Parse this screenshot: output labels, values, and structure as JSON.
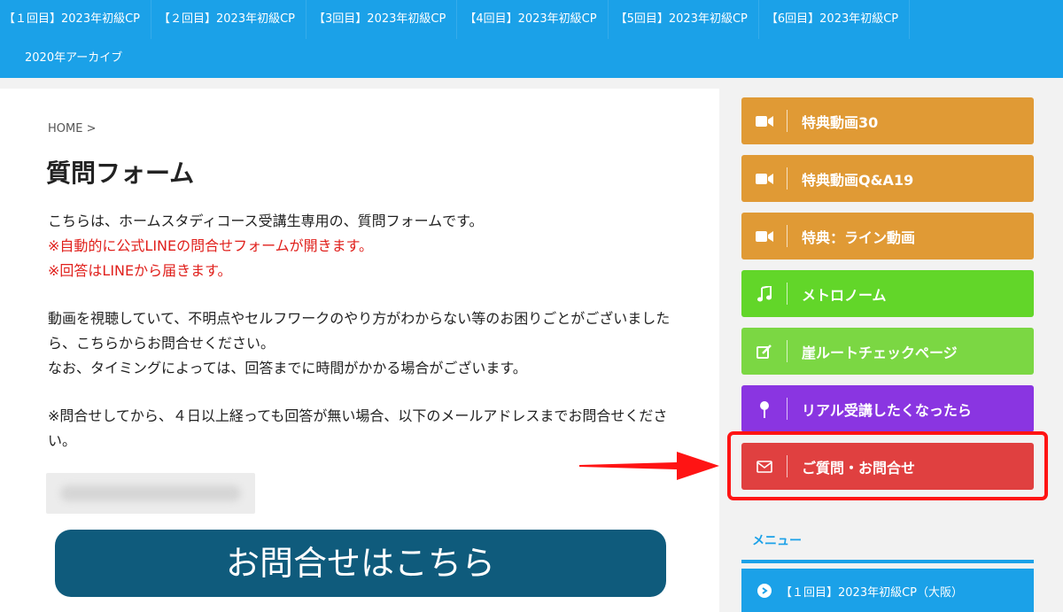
{
  "topnav": {
    "row1": [
      "【１回目】2023年初級CP",
      "【２回目】2023年初級CP",
      "【3回目】2023年初級CP",
      "【4回目】2023年初級CP",
      "【5回目】2023年初級CP",
      "【6回目】2023年初級CP"
    ],
    "row2": [
      "2020年アーカイブ"
    ]
  },
  "main": {
    "breadcrumb": "HOME >",
    "title": "質問フォーム",
    "intro": "こちらは、ホームスタディコース受講生専用の、質問フォームです。",
    "note1": "※自動的に公式LINEの問合せフォームが開きます。",
    "note2": "※回答はLINEから届きます。",
    "para2a": "動画を視聴していて、不明点やセルフワークのやり方がわからない等のお困りごとがございましたら、こちらからお問合せください。",
    "para2b": "なお、タイミングによっては、回答までに時間がかかる場合がございます。",
    "para3": "※問合せしてから、４日以上経っても回答が無い場合、以下のメールアドレスまでお問合せください。",
    "contact_button": "お問合せはこちら"
  },
  "sidebar": {
    "buttons": [
      {
        "label": "特典動画30",
        "icon": "video-camera-icon",
        "color": "#e09a35"
      },
      {
        "label": "特典動画Q&A19",
        "icon": "video-camera-icon",
        "color": "#e09a35"
      },
      {
        "label": "特典：ライン動画",
        "icon": "video-camera-icon",
        "color": "#e09a35"
      },
      {
        "label": "メトロノーム",
        "icon": "music-note-icon",
        "color": "#62d629"
      },
      {
        "label": "崖ルートチェックページ",
        "icon": "edit-icon",
        "color": "#7bd743"
      },
      {
        "label": "リアル受講したくなったら",
        "icon": "map-pin-icon",
        "color": "#8a35e1"
      },
      {
        "label": "ご質問・お問合せ",
        "icon": "envelope-icon",
        "color": "#e04040"
      }
    ],
    "menu_title": "メニュー",
    "menu_items": [
      "【１回目】2023年初級CP（大阪）"
    ]
  },
  "colors": {
    "nav": "#1ba1e8",
    "highlight": "#ff1414",
    "contact_button": "#0f5b7c"
  }
}
